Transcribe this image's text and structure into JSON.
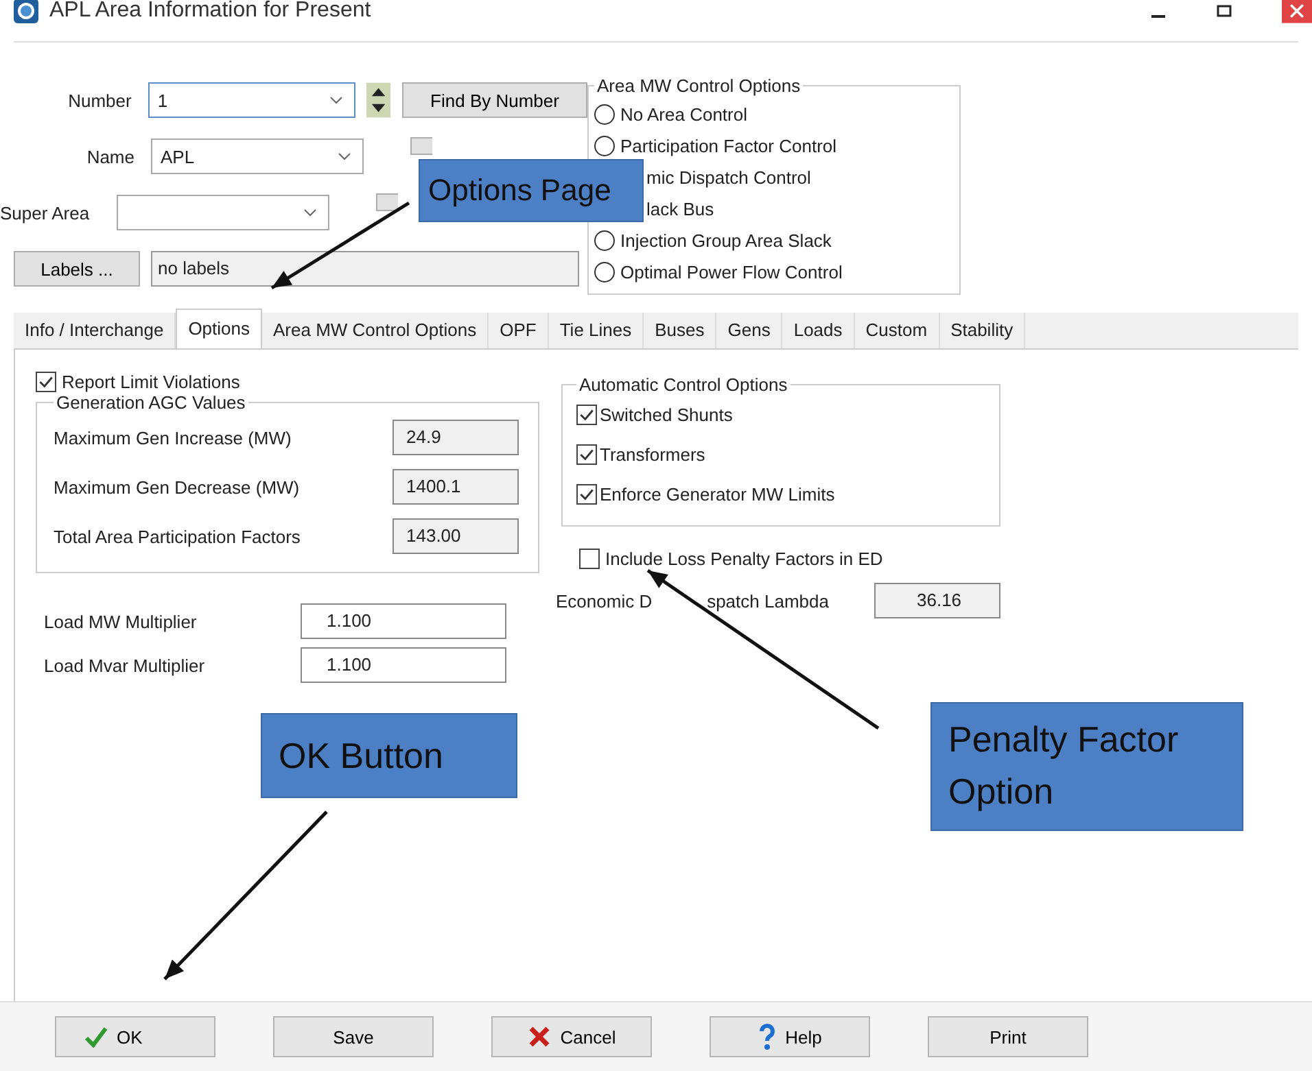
{
  "window": {
    "title": "APL Area Information for Present"
  },
  "identity": {
    "fields": [
      {
        "label": "Number",
        "value": "1",
        "kind": "spin"
      },
      {
        "label": "Name",
        "value": "APL",
        "kind": "combo"
      },
      {
        "label": "Super Area",
        "kind": "combo"
      }
    ],
    "find_buttons": [
      "Find By Number"
    ],
    "labels_button": "Labels ...",
    "labels_value": "no labels"
  },
  "area_mw_control": {
    "title": "Area MW Control Options",
    "options": [
      {
        "label": "No Area Control",
        "selected": false
      },
      {
        "label": "Participation Factor Control",
        "selected": false
      },
      {
        "label": "mic Dispatch Control"
      },
      {
        "label": "lack Bus"
      },
      {
        "label": "Injection Group Area Slack",
        "selected": false
      },
      {
        "label": "Optimal Power Flow Control",
        "selected": false
      }
    ]
  },
  "tabs": [
    {
      "label": "Info / Interchange",
      "selected": false
    },
    {
      "label": "Options",
      "selected": true
    },
    {
      "label": "Area MW Control Options",
      "selected": false
    },
    {
      "label": "OPF",
      "selected": false
    },
    {
      "label": "Tie Lines",
      "selected": false
    },
    {
      "label": "Buses",
      "selected": false
    },
    {
      "label": "Gens",
      "selected": false
    },
    {
      "label": "Loads",
      "selected": false
    },
    {
      "label": "Custom",
      "selected": false
    },
    {
      "label": "Stability",
      "selected": false
    }
  ],
  "options_page": {
    "report_limit_violations": {
      "label": "Report Limit Violations",
      "checked": true
    },
    "agc": {
      "title": "Generation AGC Values",
      "rows": [
        {
          "label": "Maximum Gen Increase (MW)",
          "value": "24.9"
        },
        {
          "label": "Maximum Gen Decrease (MW)",
          "value": "1400.1"
        },
        {
          "label": "Total Area  Participation Factors",
          "value": "143.00"
        }
      ]
    },
    "multipliers": [
      {
        "label": "Load MW Multiplier",
        "value": "1.100"
      },
      {
        "label": "Load Mvar Multiplier",
        "value": "1.100"
      }
    ],
    "automatic_control": {
      "title": "Automatic Control Options",
      "items": [
        {
          "label": "Switched Shunts",
          "checked": true
        },
        {
          "label": "Transformers",
          "checked": true
        },
        {
          "label": "Enforce Generator MW Limits",
          "checked": true
        }
      ]
    },
    "loss_penalty": {
      "label": "Include Loss Penalty Factors in ED",
      "checked": false
    },
    "lambda": {
      "label_parts": [
        "Economic D",
        "spatch Lambda"
      ],
      "value": "36.16"
    }
  },
  "buttons": [
    {
      "label": "OK",
      "kind": "ok"
    },
    {
      "label": "Save",
      "kind": "plain"
    },
    {
      "label": "Cancel",
      "kind": "cancel"
    },
    {
      "label": "Help",
      "kind": "help"
    },
    {
      "label": "Print",
      "kind": "plain"
    }
  ],
  "annotations": [
    {
      "text": "Options Page",
      "kind": "options"
    },
    {
      "text": "OK Button",
      "kind": "ok"
    },
    {
      "text": "Penalty Factor Option",
      "kind": "penalty"
    }
  ]
}
